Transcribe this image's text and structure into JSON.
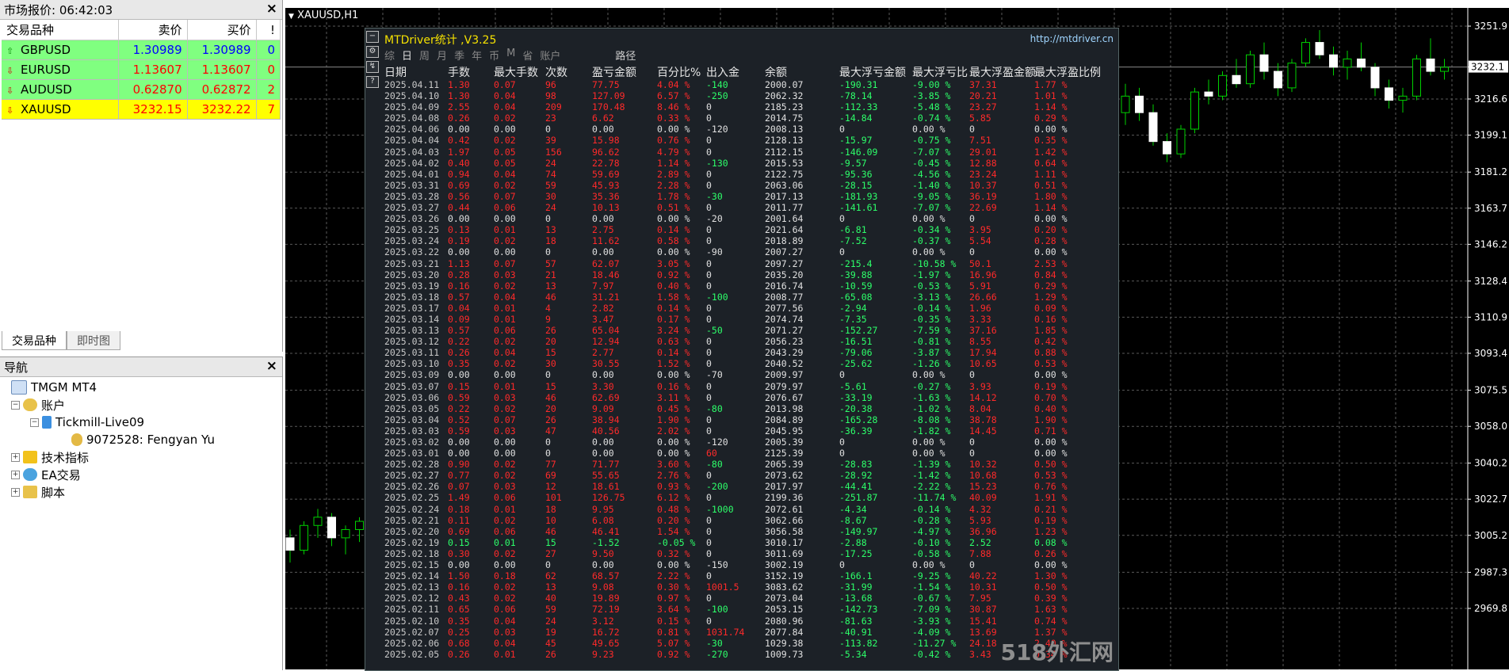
{
  "market_watch": {
    "title": "市场报价: 06:42:03",
    "col_symbol": "交易品种",
    "col_bid": "卖价",
    "col_ask": "买价",
    "col_flag": "!",
    "rows": [
      {
        "symbol": "GBPUSD",
        "bid": "1.30989",
        "ask": "1.30989",
        "spread": "0",
        "bg": "#80ff80",
        "color": "#0000ff",
        "dir": "up"
      },
      {
        "symbol": "EURUSD",
        "bid": "1.13607",
        "ask": "1.13607",
        "spread": "0",
        "bg": "#80ff80",
        "color": "#ff0000",
        "dir": "down"
      },
      {
        "symbol": "AUDUSD",
        "bid": "0.62870",
        "ask": "0.62872",
        "spread": "2",
        "bg": "#80ff80",
        "color": "#ff0000",
        "dir": "down"
      },
      {
        "symbol": "XAUUSD",
        "bid": "3232.15",
        "ask": "3232.22",
        "spread": "7",
        "bg": "#ffff00",
        "color": "#ff0000",
        "dir": "down"
      }
    ],
    "tabs": [
      "交易品种",
      "即时图"
    ]
  },
  "navigator": {
    "title": "导航",
    "nodes": {
      "root": "TMGM MT4",
      "accounts": "账户",
      "server": "Tickmill-Live09",
      "account": "9072528: Fengyan Yu",
      "indicators": "技术指标",
      "ea": "EA交易",
      "scripts": "脚本"
    }
  },
  "chart": {
    "title": "XAUUSD,H1",
    "price_label": "3232.1",
    "axis": [
      "3251.9",
      "3232.1",
      "3216.6",
      "3199.1",
      "3181.2",
      "3163.7",
      "3146.2",
      "3128.4",
      "3110.9",
      "3093.4",
      "3075.5",
      "3058.0",
      "3040.2",
      "3022.7",
      "3005.2",
      "2987.3",
      "2969.8"
    ]
  },
  "panel": {
    "title": "MTDriver统计 ,V3.25",
    "url": "http://mtdriver.cn",
    "tabs": [
      "综",
      "日",
      "周",
      "月",
      "季",
      "年",
      "币",
      "M",
      "省",
      "账户"
    ],
    "path_label": "路径",
    "headers": [
      "日期",
      "手数",
      "最大手数",
      "次数",
      "盈亏金额",
      "百分比%",
      "出入金",
      "余额",
      "最大浮亏金额",
      "最大浮亏比",
      "最大浮盈金额",
      "最大浮盈比例"
    ],
    "rows": [
      [
        "2025.04.11",
        "1.30",
        "0.07",
        "96",
        "77.75",
        "4.04 %",
        "-140",
        "2000.07",
        "-190.31",
        "-9.00 %",
        "37.31",
        "1.77 %"
      ],
      [
        "2025.04.10",
        "1.30",
        "0.04",
        "98",
        "127.09",
        "6.57 %",
        "-250",
        "2062.32",
        "-78.14",
        "-3.85 %",
        "20.21",
        "1.01 %"
      ],
      [
        "2025.04.09",
        "2.55",
        "0.04",
        "209",
        "170.48",
        "8.46 %",
        "0",
        "2185.23",
        "-112.33",
        "-5.48 %",
        "23.27",
        "1.14 %"
      ],
      [
        "2025.04.08",
        "0.26",
        "0.02",
        "23",
        "6.62",
        "0.33 %",
        "0",
        "2014.75",
        "-14.84",
        "-0.74 %",
        "5.85",
        "0.29 %"
      ],
      [
        "2025.04.06",
        "0.00",
        "0.00",
        "0",
        "0.00",
        "0.00 %",
        "-120",
        "2008.13",
        "0",
        "0.00 %",
        "0",
        "0.00 %"
      ],
      [
        "2025.04.04",
        "0.42",
        "0.02",
        "39",
        "15.98",
        "0.76 %",
        "0",
        "2128.13",
        "-15.97",
        "-0.75 %",
        "7.51",
        "0.35 %"
      ],
      [
        "2025.04.03",
        "1.97",
        "0.05",
        "156",
        "96.62",
        "4.79 %",
        "0",
        "2112.15",
        "-146.09",
        "-7.07 %",
        "29.01",
        "1.42 %"
      ],
      [
        "2025.04.02",
        "0.40",
        "0.05",
        "24",
        "22.78",
        "1.14 %",
        "-130",
        "2015.53",
        "-9.57",
        "-0.45 %",
        "12.88",
        "0.64 %"
      ],
      [
        "2025.04.01",
        "0.94",
        "0.04",
        "74",
        "59.69",
        "2.89 %",
        "0",
        "2122.75",
        "-95.36",
        "-4.56 %",
        "23.24",
        "1.11 %"
      ],
      [
        "2025.03.31",
        "0.69",
        "0.02",
        "59",
        "45.93",
        "2.28 %",
        "0",
        "2063.06",
        "-28.15",
        "-1.40 %",
        "10.37",
        "0.51 %"
      ],
      [
        "2025.03.28",
        "0.56",
        "0.07",
        "30",
        "35.36",
        "1.78 %",
        "-30",
        "2017.13",
        "-181.93",
        "-9.05 %",
        "36.19",
        "1.80 %"
      ],
      [
        "2025.03.27",
        "0.44",
        "0.06",
        "24",
        "10.13",
        "0.51 %",
        "0",
        "2011.77",
        "-141.61",
        "-7.07 %",
        "22.69",
        "1.14 %"
      ],
      [
        "2025.03.26",
        "0.00",
        "0.00",
        "0",
        "0.00",
        "0.00 %",
        "-20",
        "2001.64",
        "0",
        "0.00 %",
        "0",
        "0.00 %"
      ],
      [
        "2025.03.25",
        "0.13",
        "0.01",
        "13",
        "2.75",
        "0.14 %",
        "0",
        "2021.64",
        "-6.81",
        "-0.34 %",
        "3.95",
        "0.20 %"
      ],
      [
        "2025.03.24",
        "0.19",
        "0.02",
        "18",
        "11.62",
        "0.58 %",
        "0",
        "2018.89",
        "-7.52",
        "-0.37 %",
        "5.54",
        "0.28 %"
      ],
      [
        "2025.03.22",
        "0.00",
        "0.00",
        "0",
        "0.00",
        "0.00 %",
        "-90",
        "2007.27",
        "0",
        "0.00 %",
        "0",
        "0.00 %"
      ],
      [
        "2025.03.21",
        "1.13",
        "0.07",
        "57",
        "62.07",
        "3.05 %",
        "0",
        "2097.27",
        "-215.4",
        "-10.58 %",
        "50.1",
        "2.53 %"
      ],
      [
        "2025.03.20",
        "0.28",
        "0.03",
        "21",
        "18.46",
        "0.92 %",
        "0",
        "2035.20",
        "-39.88",
        "-1.97 %",
        "16.96",
        "0.84 %"
      ],
      [
        "2025.03.19",
        "0.16",
        "0.02",
        "13",
        "7.97",
        "0.40 %",
        "0",
        "2016.74",
        "-10.59",
        "-0.53 %",
        "5.91",
        "0.29 %"
      ],
      [
        "2025.03.18",
        "0.57",
        "0.04",
        "46",
        "31.21",
        "1.58 %",
        "-100",
        "2008.77",
        "-65.08",
        "-3.13 %",
        "26.66",
        "1.29 %"
      ],
      [
        "2025.03.17",
        "0.04",
        "0.01",
        "4",
        "2.82",
        "0.14 %",
        "0",
        "2077.56",
        "-2.94",
        "-0.14 %",
        "1.96",
        "0.09 %"
      ],
      [
        "2025.03.14",
        "0.09",
        "0.01",
        "9",
        "3.47",
        "0.17 %",
        "0",
        "2074.74",
        "-7.35",
        "-0.35 %",
        "3.33",
        "0.16 %"
      ],
      [
        "2025.03.13",
        "0.57",
        "0.06",
        "26",
        "65.04",
        "3.24 %",
        "-50",
        "2071.27",
        "-152.27",
        "-7.59 %",
        "37.16",
        "1.85 %"
      ],
      [
        "2025.03.12",
        "0.22",
        "0.02",
        "20",
        "12.94",
        "0.63 %",
        "0",
        "2056.23",
        "-16.51",
        "-0.81 %",
        "8.55",
        "0.42 %"
      ],
      [
        "2025.03.11",
        "0.26",
        "0.04",
        "15",
        "2.77",
        "0.14 %",
        "0",
        "2043.29",
        "-79.06",
        "-3.87 %",
        "17.94",
        "0.88 %"
      ],
      [
        "2025.03.10",
        "0.35",
        "0.02",
        "30",
        "30.55",
        "1.52 %",
        "0",
        "2040.52",
        "-25.62",
        "-1.26 %",
        "10.65",
        "0.53 %"
      ],
      [
        "2025.03.09",
        "0.00",
        "0.00",
        "0",
        "0.00",
        "0.00 %",
        "-70",
        "2009.97",
        "0",
        "0.00 %",
        "0",
        "0.00 %"
      ],
      [
        "2025.03.07",
        "0.15",
        "0.01",
        "15",
        "3.30",
        "0.16 %",
        "0",
        "2079.97",
        "-5.61",
        "-0.27 %",
        "3.93",
        "0.19 %"
      ],
      [
        "2025.03.06",
        "0.59",
        "0.03",
        "46",
        "62.69",
        "3.11 %",
        "0",
        "2076.67",
        "-33.19",
        "-1.63 %",
        "14.12",
        "0.70 %"
      ],
      [
        "2025.03.05",
        "0.22",
        "0.02",
        "20",
        "9.09",
        "0.45 %",
        "-80",
        "2013.98",
        "-20.38",
        "-1.02 %",
        "8.04",
        "0.40 %"
      ],
      [
        "2025.03.04",
        "0.52",
        "0.07",
        "26",
        "38.94",
        "1.90 %",
        "0",
        "2084.89",
        "-165.28",
        "-8.08 %",
        "38.78",
        "1.90 %"
      ],
      [
        "2025.03.03",
        "0.59",
        "0.03",
        "47",
        "40.56",
        "2.02 %",
        "0",
        "2045.95",
        "-36.39",
        "-1.82 %",
        "14.45",
        "0.71 %"
      ],
      [
        "2025.03.02",
        "0.00",
        "0.00",
        "0",
        "0.00",
        "0.00 %",
        "-120",
        "2005.39",
        "0",
        "0.00 %",
        "0",
        "0.00 %"
      ],
      [
        "2025.03.01",
        "0.00",
        "0.00",
        "0",
        "0.00",
        "0.00 %",
        "60",
        "2125.39",
        "0",
        "0.00 %",
        "0",
        "0.00 %"
      ],
      [
        "2025.02.28",
        "0.90",
        "0.02",
        "77",
        "71.77",
        "3.60 %",
        "-80",
        "2065.39",
        "-28.83",
        "-1.39 %",
        "10.32",
        "0.50 %"
      ],
      [
        "2025.02.27",
        "0.77",
        "0.02",
        "69",
        "55.65",
        "2.76 %",
        "0",
        "2073.62",
        "-28.92",
        "-1.42 %",
        "10.68",
        "0.53 %"
      ],
      [
        "2025.02.26",
        "0.07",
        "0.03",
        "12",
        "18.61",
        "0.93 %",
        "-200",
        "2017.97",
        "-44.41",
        "-2.22 %",
        "15.23",
        "0.76 %"
      ],
      [
        "2025.02.25",
        "1.49",
        "0.06",
        "101",
        "126.75",
        "6.12 %",
        "0",
        "2199.36",
        "-251.87",
        "-11.74 %",
        "40.09",
        "1.91 %"
      ],
      [
        "2025.02.24",
        "0.18",
        "0.01",
        "18",
        "9.95",
        "0.48 %",
        "-1000",
        "2072.61",
        "-4.34",
        "-0.14 %",
        "4.32",
        "0.21 %"
      ],
      [
        "2025.02.21",
        "0.11",
        "0.02",
        "10",
        "6.08",
        "0.20 %",
        "0",
        "3062.66",
        "-8.67",
        "-0.28 %",
        "5.93",
        "0.19 %"
      ],
      [
        "2025.02.20",
        "0.69",
        "0.06",
        "46",
        "46.41",
        "1.54 %",
        "0",
        "3056.58",
        "-149.97",
        "-4.97 %",
        "36.96",
        "1.23 %"
      ],
      [
        "2025.02.19",
        "0.15",
        "0.01",
        "15",
        "-1.52",
        "-0.05 %",
        "0",
        "3010.17",
        "-2.88",
        "-0.10 %",
        "2.52",
        "0.08 %"
      ],
      [
        "2025.02.18",
        "0.30",
        "0.02",
        "27",
        "9.50",
        "0.32 %",
        "0",
        "3011.69",
        "-17.25",
        "-0.58 %",
        "7.88",
        "0.26 %"
      ],
      [
        "2025.02.15",
        "0.00",
        "0.00",
        "0",
        "0.00",
        "0.00 %",
        "-150",
        "3002.19",
        "0",
        "0.00 %",
        "0",
        "0.00 %"
      ],
      [
        "2025.02.14",
        "1.50",
        "0.18",
        "62",
        "68.57",
        "2.22 %",
        "0",
        "3152.19",
        "-166.1",
        "-9.25 %",
        "40.22",
        "1.30 %"
      ],
      [
        "2025.02.13",
        "0.16",
        "0.02",
        "13",
        "9.08",
        "0.30 %",
        "1001.5",
        "3083.62",
        "-31.99",
        "-1.54 %",
        "10.31",
        "0.50 %"
      ],
      [
        "2025.02.12",
        "0.43",
        "0.02",
        "40",
        "19.89",
        "0.97 %",
        "0",
        "2073.04",
        "-13.68",
        "-0.67 %",
        "7.95",
        "0.39 %"
      ],
      [
        "2025.02.11",
        "0.65",
        "0.06",
        "59",
        "72.19",
        "3.64 %",
        "-100",
        "2053.15",
        "-142.73",
        "-7.09 %",
        "30.87",
        "1.63 %"
      ],
      [
        "2025.02.10",
        "0.35",
        "0.04",
        "24",
        "3.12",
        "0.15 %",
        "0",
        "2080.96",
        "-81.63",
        "-3.93 %",
        "15.41",
        "0.74 %"
      ],
      [
        "2025.02.07",
        "0.25",
        "0.03",
        "19",
        "16.72",
        "0.81 %",
        "1031.74",
        "2077.84",
        "-40.91",
        "-4.09 %",
        "13.69",
        "1.37 %"
      ],
      [
        "2025.02.06",
        "0.68",
        "0.04",
        "45",
        "49.65",
        "5.07 %",
        "-30",
        "1029.38",
        "-113.82",
        "-11.27 %",
        "24.18",
        "2.40 %"
      ],
      [
        "2025.02.05",
        "0.26",
        "0.01",
        "26",
        "9.23",
        "0.92 %",
        "-270",
        "1009.73",
        "-5.34",
        "-0.42 %",
        "3.43",
        "0.34 %"
      ]
    ]
  },
  "watermark": "518外汇网"
}
